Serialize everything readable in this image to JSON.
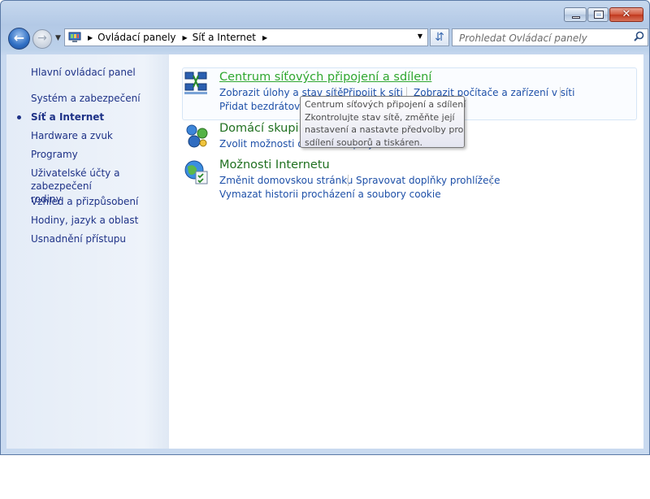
{
  "window": {
    "caption_buttons": {
      "minimize": "minimize",
      "maximize": "maximize",
      "close": "✕"
    }
  },
  "address_bar": {
    "crumbs": [
      "Ovládací panely",
      "Síť a Internet"
    ],
    "search_placeholder": "Prohledat Ovládací panely"
  },
  "sidebar": {
    "items": [
      {
        "label": "Hlavní ovládací panel",
        "active": false
      },
      {
        "label": "Systém a zabezpečení",
        "active": false
      },
      {
        "label": "Síť a Internet",
        "active": true
      },
      {
        "label": "Hardware a zvuk",
        "active": false
      },
      {
        "label": "Programy",
        "active": false
      },
      {
        "label": "Uživatelské účty a zabezpečení",
        "label2": "rodiny",
        "active": false
      },
      {
        "label": "Vzhled a přizpůsobení",
        "active": false
      },
      {
        "label": "Hodiny, jazyk a oblast",
        "active": false
      },
      {
        "label": "Usnadnění přístupu",
        "active": false
      }
    ]
  },
  "categories": [
    {
      "title": "Centrum síťových připojení a sdílení",
      "icon": "network-center-icon",
      "links": [
        "Zobrazit úlohy a stav sítě",
        "Připojit k síti",
        "Zobrazit počítače a zařízení v síti",
        "Přidat bezdrátové zařízení do sítě"
      ]
    },
    {
      "title": "Domácí skupina",
      "icon": "homegroup-icon",
      "links": [
        "Zvolit možnosti domácí skupiny a sdílení"
      ]
    },
    {
      "title": "Možnosti Internetu",
      "icon": "internet-options-icon",
      "links": [
        "Změnit domovskou stránku",
        "Spravovat doplňky prohlížeče",
        "Vymazat historii procházení a soubory cookie"
      ]
    }
  ],
  "tooltip": {
    "lines": [
      "Centrum síťových připojení a sdílení",
      "Zkontrolujte stav sítě, změňte její",
      "nastavení a nastavte předvolby pro",
      "sdílení souborů a tiskáren."
    ]
  },
  "colors": {
    "link": "#1e50a8",
    "category_title": "#207020",
    "category_hover": "#2fa72f",
    "sidebar_text": "#1e3287"
  }
}
